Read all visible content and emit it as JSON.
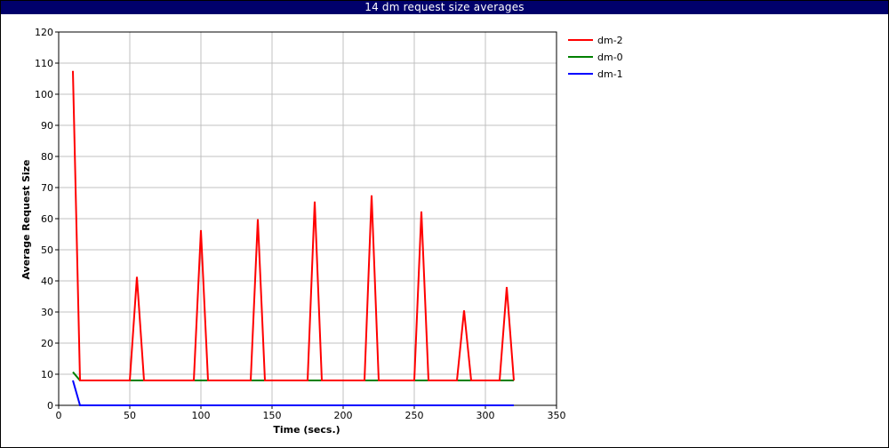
{
  "chart_data": {
    "type": "line",
    "title": "14 dm request size averages",
    "xlabel": "Time (secs.)",
    "ylabel": "Average Request Size",
    "xlim": [
      0,
      350
    ],
    "ylim": [
      0,
      120
    ],
    "xticks": [
      0,
      50,
      100,
      150,
      200,
      250,
      300,
      350
    ],
    "yticks": [
      0,
      10,
      20,
      30,
      40,
      50,
      60,
      70,
      80,
      90,
      100,
      110,
      120
    ],
    "grid": true,
    "legend_position": "top-right, outside plot",
    "series": [
      {
        "name": "dm-2",
        "color": "#ff0000",
        "points": [
          [
            10,
            107.5
          ],
          [
            15,
            8
          ],
          [
            50,
            8
          ],
          [
            55,
            41.3
          ],
          [
            60,
            8
          ],
          [
            95,
            8
          ],
          [
            100,
            56.3
          ],
          [
            105,
            8
          ],
          [
            135,
            8
          ],
          [
            140,
            59.8
          ],
          [
            145,
            8
          ],
          [
            175,
            8
          ],
          [
            180,
            65.5
          ],
          [
            185,
            8
          ],
          [
            215,
            8
          ],
          [
            220,
            67.5
          ],
          [
            225,
            8
          ],
          [
            250,
            8
          ],
          [
            255,
            62.3
          ],
          [
            260,
            8
          ],
          [
            280,
            8
          ],
          [
            285,
            30.5
          ],
          [
            290,
            8
          ],
          [
            310,
            8
          ],
          [
            315,
            38
          ],
          [
            320,
            8
          ]
        ]
      },
      {
        "name": "dm-0",
        "color": "#008000",
        "points": [
          [
            10,
            10.7
          ],
          [
            15,
            8
          ],
          [
            320,
            8
          ]
        ]
      },
      {
        "name": "dm-1",
        "color": "#0000ff",
        "points": [
          [
            10,
            8
          ],
          [
            15,
            0
          ],
          [
            320,
            0
          ]
        ]
      }
    ]
  }
}
